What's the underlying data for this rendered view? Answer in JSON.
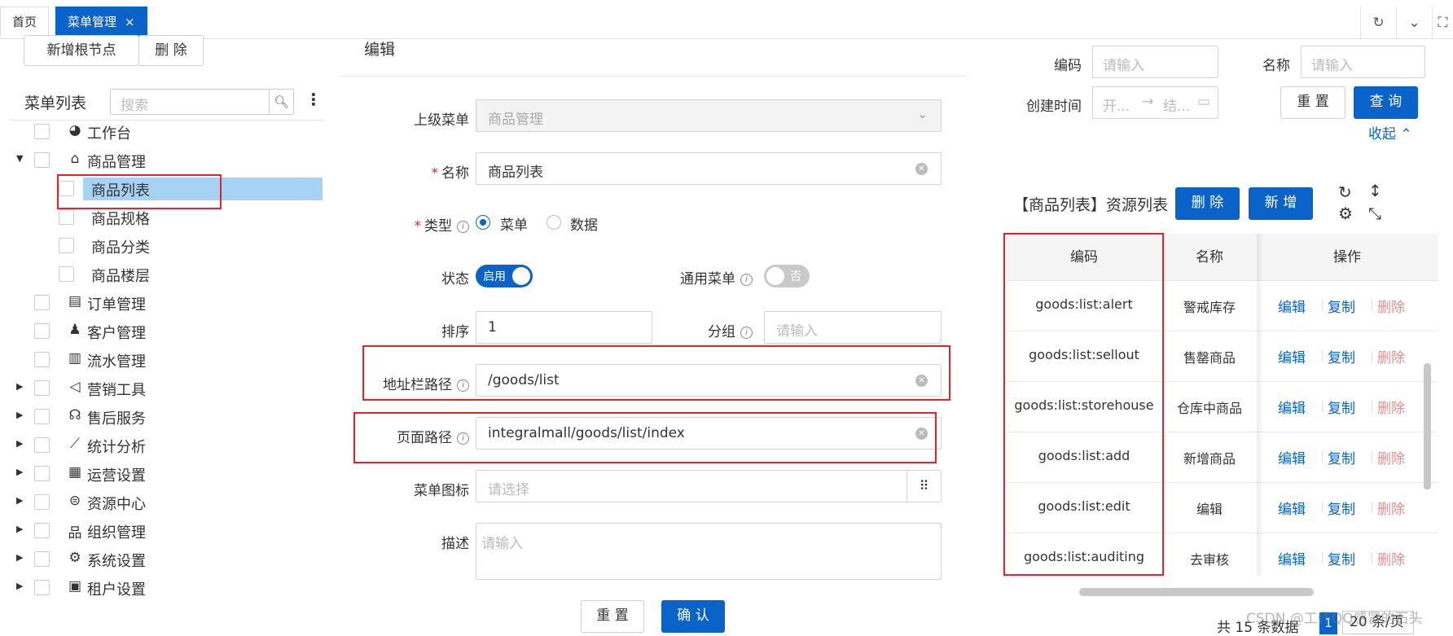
{
  "tabs": [
    {
      "label": "首页"
    },
    {
      "label": "菜单管理",
      "close": "×"
    }
  ],
  "toolbar_icons": [
    "refresh-icon",
    "chevron-down-icon",
    "fullscreen-icon"
  ],
  "left": {
    "add_root_label": "新增根节点",
    "delete_label": "删 除",
    "tree_title": "菜单列表",
    "search_placeholder": "搜索",
    "items": [
      {
        "label": "工作台",
        "icon": "◕",
        "arrow": ""
      },
      {
        "label": "商品管理",
        "icon": "⌂",
        "arrow": "▼"
      },
      {
        "label": "商品列表",
        "icon": "",
        "arrow": ""
      },
      {
        "label": "商品规格",
        "icon": "",
        "arrow": ""
      },
      {
        "label": "商品分类",
        "icon": "",
        "arrow": ""
      },
      {
        "label": "商品楼层",
        "icon": "",
        "arrow": ""
      },
      {
        "label": "订单管理",
        "icon": "▤",
        "arrow": ""
      },
      {
        "label": "客户管理",
        "icon": "♟",
        "arrow": ""
      },
      {
        "label": "流水管理",
        "icon": "▥",
        "arrow": ""
      },
      {
        "label": "营销工具",
        "icon": "◁",
        "arrow": "▶"
      },
      {
        "label": "售后服务",
        "icon": "☊",
        "arrow": "▶"
      },
      {
        "label": "统计分析",
        "icon": "⟋",
        "arrow": "▶"
      },
      {
        "label": "运营设置",
        "icon": "▦",
        "arrow": "▶"
      },
      {
        "label": "资源中心",
        "icon": "⊜",
        "arrow": "▶"
      },
      {
        "label": "组织管理",
        "icon": "品",
        "arrow": "▶"
      },
      {
        "label": "系统设置",
        "icon": "⚙",
        "arrow": "▶"
      },
      {
        "label": "租户设置",
        "icon": "▣",
        "arrow": "▶"
      }
    ]
  },
  "form": {
    "title": "编辑",
    "parent_label": "上级菜单",
    "parent_value": "商品管理",
    "name_label": "名称",
    "name_value": "商品列表",
    "type_label": "类型",
    "type_option_menu": "菜单",
    "type_option_data": "数据",
    "status_label": "状态",
    "status_on": "启用",
    "common_label": "通用菜单",
    "common_off": "否",
    "sort_label": "排序",
    "sort_value": "1",
    "group_label": "分组",
    "group_placeholder": "请输入",
    "route_label": "地址栏路径",
    "route_value": "/goods/list",
    "page_label": "页面路径",
    "page_value": "integralmall/goods/list/index",
    "icon_label": "菜单图标",
    "icon_placeholder": "请选择",
    "desc_label": "描述",
    "desc_placeholder": "请输入",
    "reset_label": "重 置",
    "confirm_label": "确 认"
  },
  "right": {
    "code_label": "编码",
    "code_placeholder": "请输入",
    "name_label": "名称",
    "name_placeholder": "请输入",
    "created_label": "创建时间",
    "start_placeholder": "开...",
    "end_placeholder": "结...",
    "reset_label": "重 置",
    "query_label": "查 询",
    "collapse_label": "收起",
    "res_title": "【商品列表】资源列表",
    "delete_label": "删 除",
    "add_label": "新 增",
    "columns": {
      "code": "编码",
      "name": "名称",
      "ops": "操作"
    },
    "rows": [
      {
        "code": "goods:list:alert",
        "name": "警戒库存"
      },
      {
        "code": "goods:list:sellout",
        "name": "售罄商品"
      },
      {
        "code": "goods:list:storehouse",
        "name": "仓库中商品"
      },
      {
        "code": "goods:list:add",
        "name": "新增商品"
      },
      {
        "code": "goods:list:edit",
        "name": "编辑"
      },
      {
        "code": "goods:list:auditing",
        "name": "去审核"
      }
    ],
    "op_edit": "编辑",
    "op_copy": "复制",
    "op_delete": "删除",
    "total_text": "共 15 条数据",
    "current_page": "1",
    "page_size": "20 条/页"
  },
  "watermark": "CSDN @工作QQ感冒的石头"
}
